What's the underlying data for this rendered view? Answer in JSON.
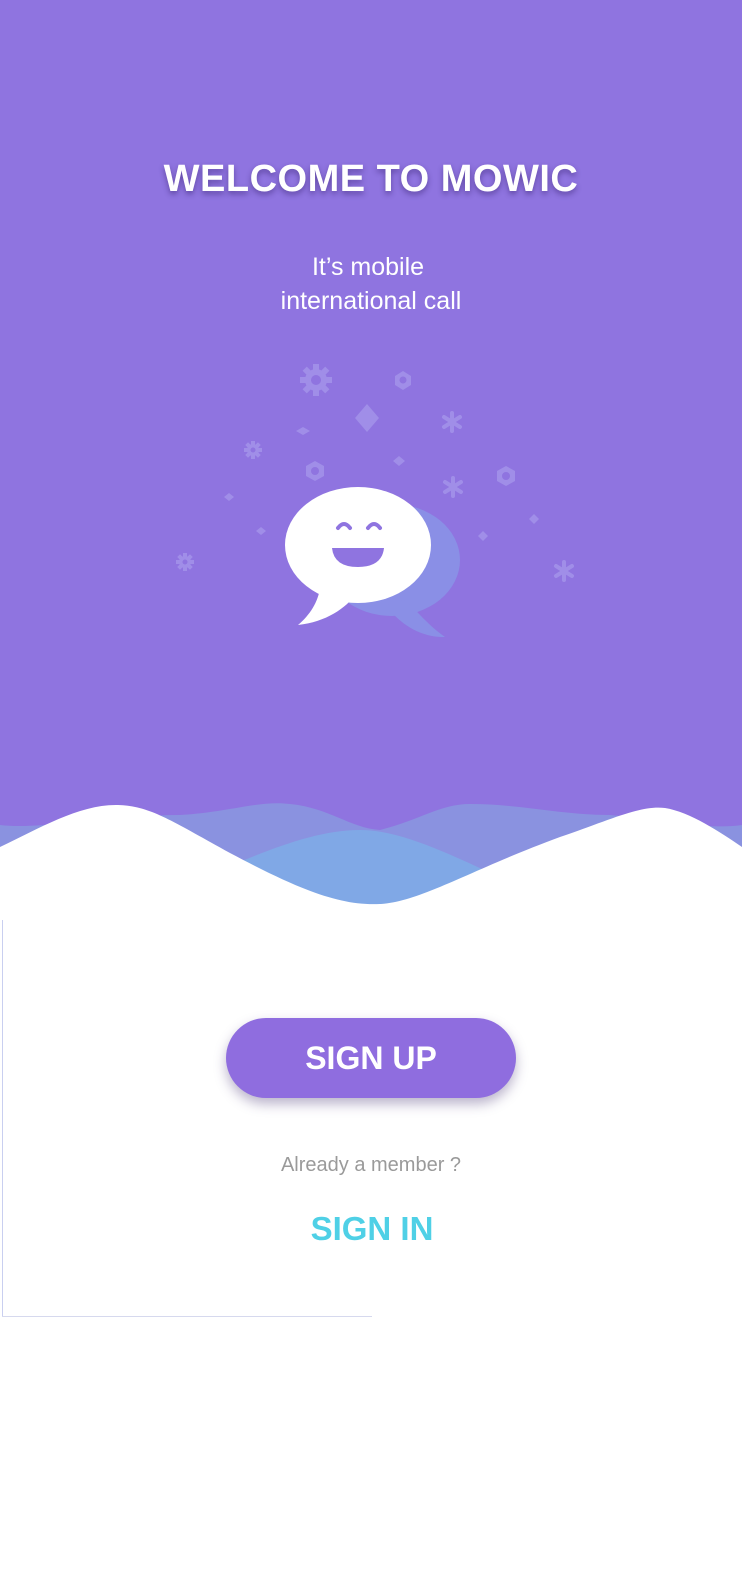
{
  "welcome": {
    "title": "WELCOME TO MOWIC",
    "subtitle_line1": "It’s mobile",
    "subtitle_line2": "international call"
  },
  "illustration": {
    "icon": "chat-bubbles-icon"
  },
  "actions": {
    "signup_label": "SIGN UP",
    "member_prompt": "Already a member ?",
    "signin_label": "SIGN IN"
  },
  "colors": {
    "brand_purple": "#8f74e0",
    "button_purple": "#8f6ddf",
    "wave_blue": "#80a8e6",
    "link_cyan": "#4fd0e6",
    "muted_text": "#9a9a9a"
  }
}
